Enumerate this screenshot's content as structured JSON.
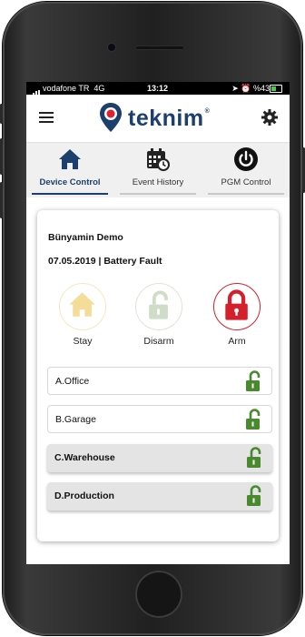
{
  "status_bar": {
    "carrier": "vodafone TR",
    "network": "4G",
    "time": "13:12",
    "battery": "%43"
  },
  "header": {
    "logo_text": "teknim",
    "logo_reg": "®",
    "brand_color": "#1c3f6e",
    "menu_icon": "hamburger-menu-icon",
    "settings_icon": "gear-icon"
  },
  "tabs": [
    {
      "label": "Device Control",
      "icon": "house-icon",
      "active": true
    },
    {
      "label": "Event History",
      "icon": "calendar-clock-icon",
      "active": false
    },
    {
      "label": "PGM Control",
      "icon": "power-icon",
      "active": false
    }
  ],
  "panel": {
    "name": "Bünyamin Demo",
    "status": "07.05.2019 | Battery Fault"
  },
  "modes": [
    {
      "label": "Stay",
      "icon": "house-icon",
      "color": "#f3dd98"
    },
    {
      "label": "Disarm",
      "icon": "unlocked-padlock-icon",
      "color": "#cfdcc7"
    },
    {
      "label": "Arm",
      "icon": "locked-padlock-icon",
      "color": "#d4202c"
    }
  ],
  "zones": [
    {
      "name": "A.Office",
      "icon": "unlocked-padlock-icon"
    },
    {
      "name": "B.Garage",
      "icon": "unlocked-padlock-icon"
    },
    {
      "name": "C.Warehouse",
      "icon": "unlocked-padlock-icon"
    },
    {
      "name": "D.Production",
      "icon": "unlocked-padlock-icon"
    }
  ],
  "colors": {
    "lock_green": "#4a8a2e",
    "arm_red": "#d4202c"
  }
}
